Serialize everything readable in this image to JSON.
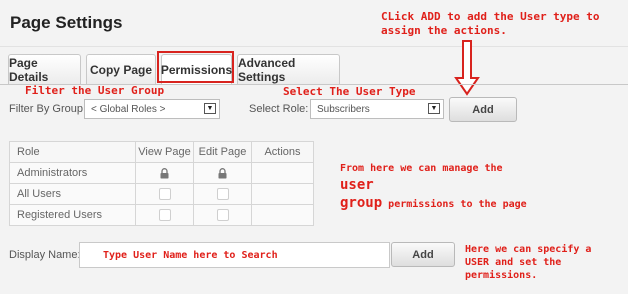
{
  "page": {
    "title": "Page Settings"
  },
  "tabs": [
    {
      "label": "Page Details"
    },
    {
      "label": "Copy Page"
    },
    {
      "label": "Permissions"
    },
    {
      "label": "Advanced Settings"
    }
  ],
  "filter": {
    "group_label": "Filter By Group:",
    "group_value": "< Global Roles >",
    "role_label": "Select Role:",
    "role_value": "Subscribers",
    "add_label": "Add"
  },
  "table": {
    "headers": [
      "Role",
      "View Page",
      "Edit Page",
      "Actions"
    ],
    "rows": [
      {
        "role": "Administrators",
        "view": "locked",
        "edit": "locked"
      },
      {
        "role": "All Users",
        "view": "unchecked",
        "edit": "unchecked"
      },
      {
        "role": "Registered Users",
        "view": "unchecked",
        "edit": "unchecked"
      }
    ]
  },
  "display": {
    "label": "Display Name:",
    "add_label": "Add"
  },
  "annotations": {
    "add_hint": "CLick ADD to add the User type to\nassign the actions.",
    "filter_hint": "Filter the User Group",
    "role_hint": "Select The User Type",
    "manage_prefix": "From here we can manage the ",
    "manage_user": "user",
    "manage_group": "group",
    "manage_suffix": " permissions to the page",
    "search_hint": "Type User Name here to Search",
    "specify_hint": "Here we can specify a\nUSER and set the\npermissions."
  },
  "colors": {
    "annotation": "#e0201a",
    "highlight_box": "#d8231e"
  }
}
